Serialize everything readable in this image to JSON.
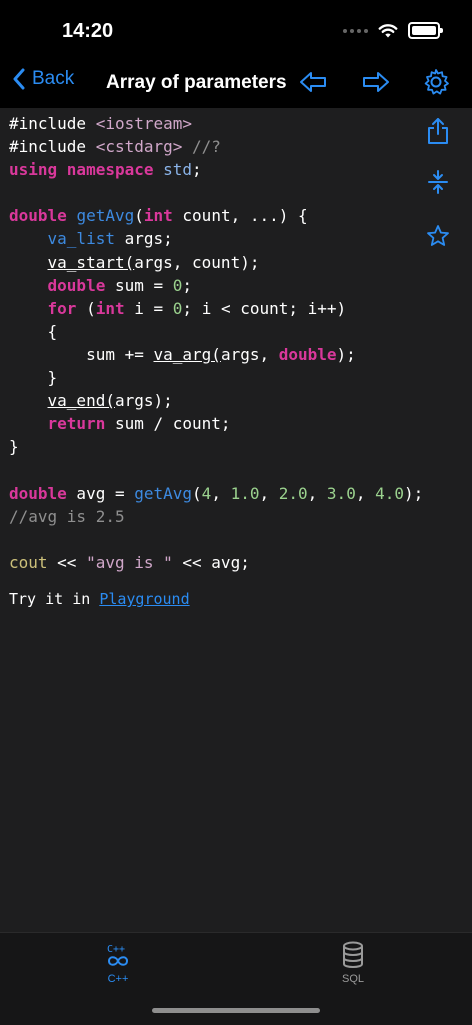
{
  "status": {
    "time": "14:20"
  },
  "nav": {
    "back_label": "Back",
    "title": "Array of parameters"
  },
  "code_lines": [
    "#include <iostream>",
    "#include <cstdarg> //?",
    "using namespace std;",
    "",
    "double getAvg(int count, ...) {",
    "    va_list args;",
    "    va_start(args, count);",
    "    double sum = 0;",
    "    for (int i = 0; i < count; i++)",
    "    {",
    "        sum += va_arg(args, double);",
    "    }",
    "    va_end(args);",
    "    return sum / count;",
    "}",
    "",
    "double avg = getAvg(4, 1.0, 2.0, 3.0, 4.0);",
    "//avg is 2.5",
    "",
    "cout << \"avg is \" << avg;"
  ],
  "try_it": {
    "prefix": "Try it in ",
    "link": "Playground"
  },
  "tabs": [
    {
      "label": "C++",
      "icon": "cpp-icon",
      "active": true
    },
    {
      "label": "SQL",
      "icon": "database-icon",
      "active": false
    }
  ],
  "colors": {
    "accent": "#2b8cf2",
    "keyword": "#d9389b",
    "function": "#3d8ae0",
    "number": "#9bd28e",
    "comment": "#8f8f8f"
  }
}
